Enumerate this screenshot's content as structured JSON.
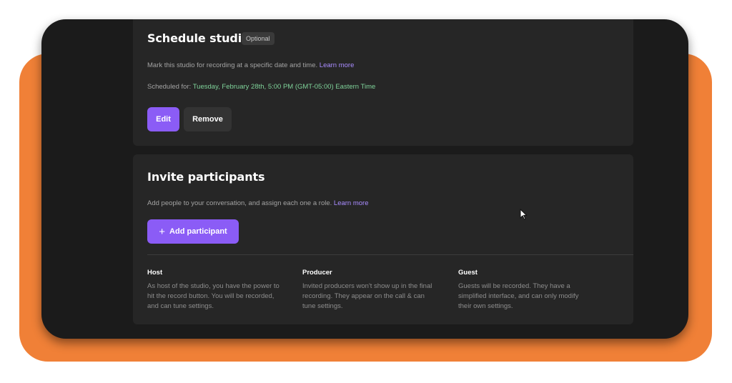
{
  "schedule": {
    "title": "Schedule studio",
    "badge": "Optional",
    "description": "Mark this studio for recording at a specific date and time.",
    "learn_more": "Learn more",
    "scheduled_label": "Scheduled for:",
    "scheduled_value": "Tuesday, February 28th, 5:00 PM (GMT-05:00) Eastern Time",
    "edit_label": "Edit",
    "remove_label": "Remove"
  },
  "invite": {
    "title": "Invite participants",
    "description": "Add people to your conversation, and assign each one a role.",
    "learn_more": "Learn more",
    "add_label": "Add participant",
    "roles": [
      {
        "name": "Host",
        "lines": [
          "As host of the studio, you have the power to",
          "hit the record button. You will be recorded,",
          "and can tune settings."
        ]
      },
      {
        "name": "Producer",
        "lines": [
          "Invited producers won't show up in the final",
          "recording. They appear on the call & can",
          "tune settings."
        ]
      },
      {
        "name": "Guest",
        "lines": [
          "Guests will be recorded. They have a",
          "simplified interface, and can only modify",
          "their own settings."
        ]
      }
    ]
  },
  "colors": {
    "accent": "#8b5cf6",
    "link": "#a98cff",
    "scheduled": "#7fd39a",
    "backdrop": "#f08037",
    "panel": "#262626",
    "window": "#1b1b1b"
  },
  "icons": [
    "plus-icon",
    "mouse-cursor-icon"
  ]
}
